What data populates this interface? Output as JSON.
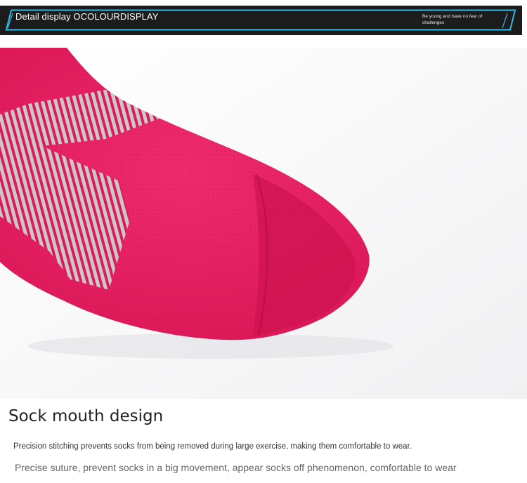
{
  "banner": {
    "title": "Detail display OCOLOURDISPLAY",
    "slogan": "Be young and have no fear of challenges",
    "accent_color": "#2fb8e6",
    "background_color": "#1c1c1c"
  },
  "product_photo": {
    "subject": "pink athletic sock with grey striped chevron pattern",
    "sock_color": "#e0195b",
    "stripe_color": "#c9c9c9"
  },
  "section": {
    "title": "Sock mouth design",
    "description_primary": "Precision stitching prevents socks from being removed during large exercise, making them comfortable to wear.",
    "description_secondary": "Precise suture, prevent socks in a big movement, appear socks off phenomenon, comfortable to wear"
  }
}
